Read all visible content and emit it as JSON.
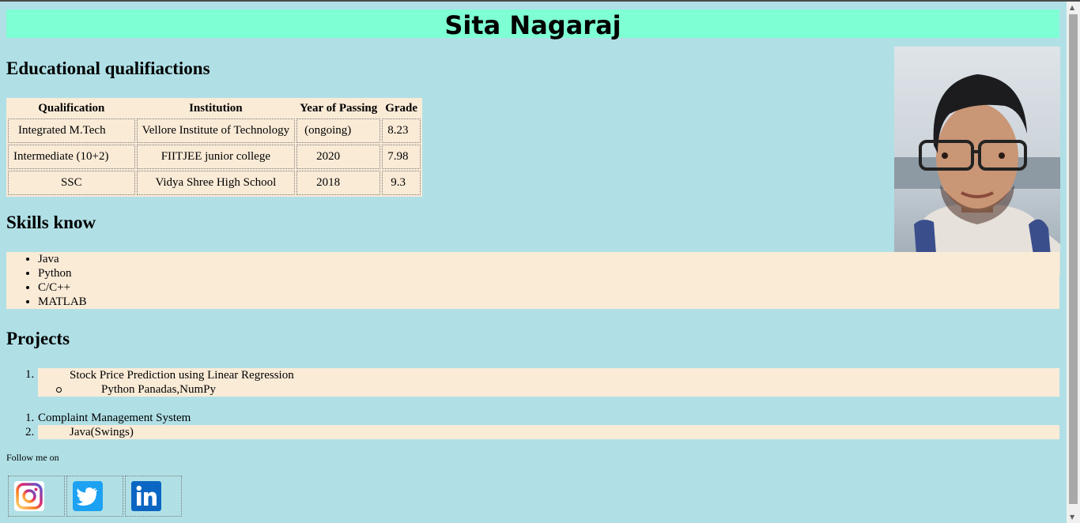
{
  "header": {
    "name": "Sita Nagaraj"
  },
  "education": {
    "heading": "Educational qualifiactions",
    "columns": [
      "Qualification",
      "Institution",
      "Year of Passing",
      "Grade"
    ],
    "rows": [
      [
        "Integrated M.Tech",
        "Vellore Institute of Technology",
        "(ongoing)",
        "8.23"
      ],
      [
        "Intermediate (10+2)",
        "FIITJEE junior college",
        "2020",
        "7.98"
      ],
      [
        "SSC",
        "Vidya Shree High School",
        "2018",
        "9.3"
      ]
    ]
  },
  "skills": {
    "heading": "Skills know",
    "items": [
      "Java",
      "Python",
      "C/C++",
      "MATLAB"
    ]
  },
  "projects": {
    "heading": "Projects",
    "project1": {
      "num": "1.",
      "title": "Stock Price Prediction using Linear Regression",
      "tech": "Python Panadas,NumPy"
    },
    "project2": {
      "num1": "1.",
      "title": "Complaint Management System",
      "num2": "2.",
      "tech": "Java(Swings)"
    }
  },
  "follow": {
    "label": "Follow me on",
    "icons": [
      "instagram-icon",
      "twitter-icon",
      "linkedin-icon"
    ]
  },
  "colors": {
    "page_bg": "#b0e0e6",
    "header_bg": "#7fffd4",
    "box_bg": "#faebd7"
  }
}
